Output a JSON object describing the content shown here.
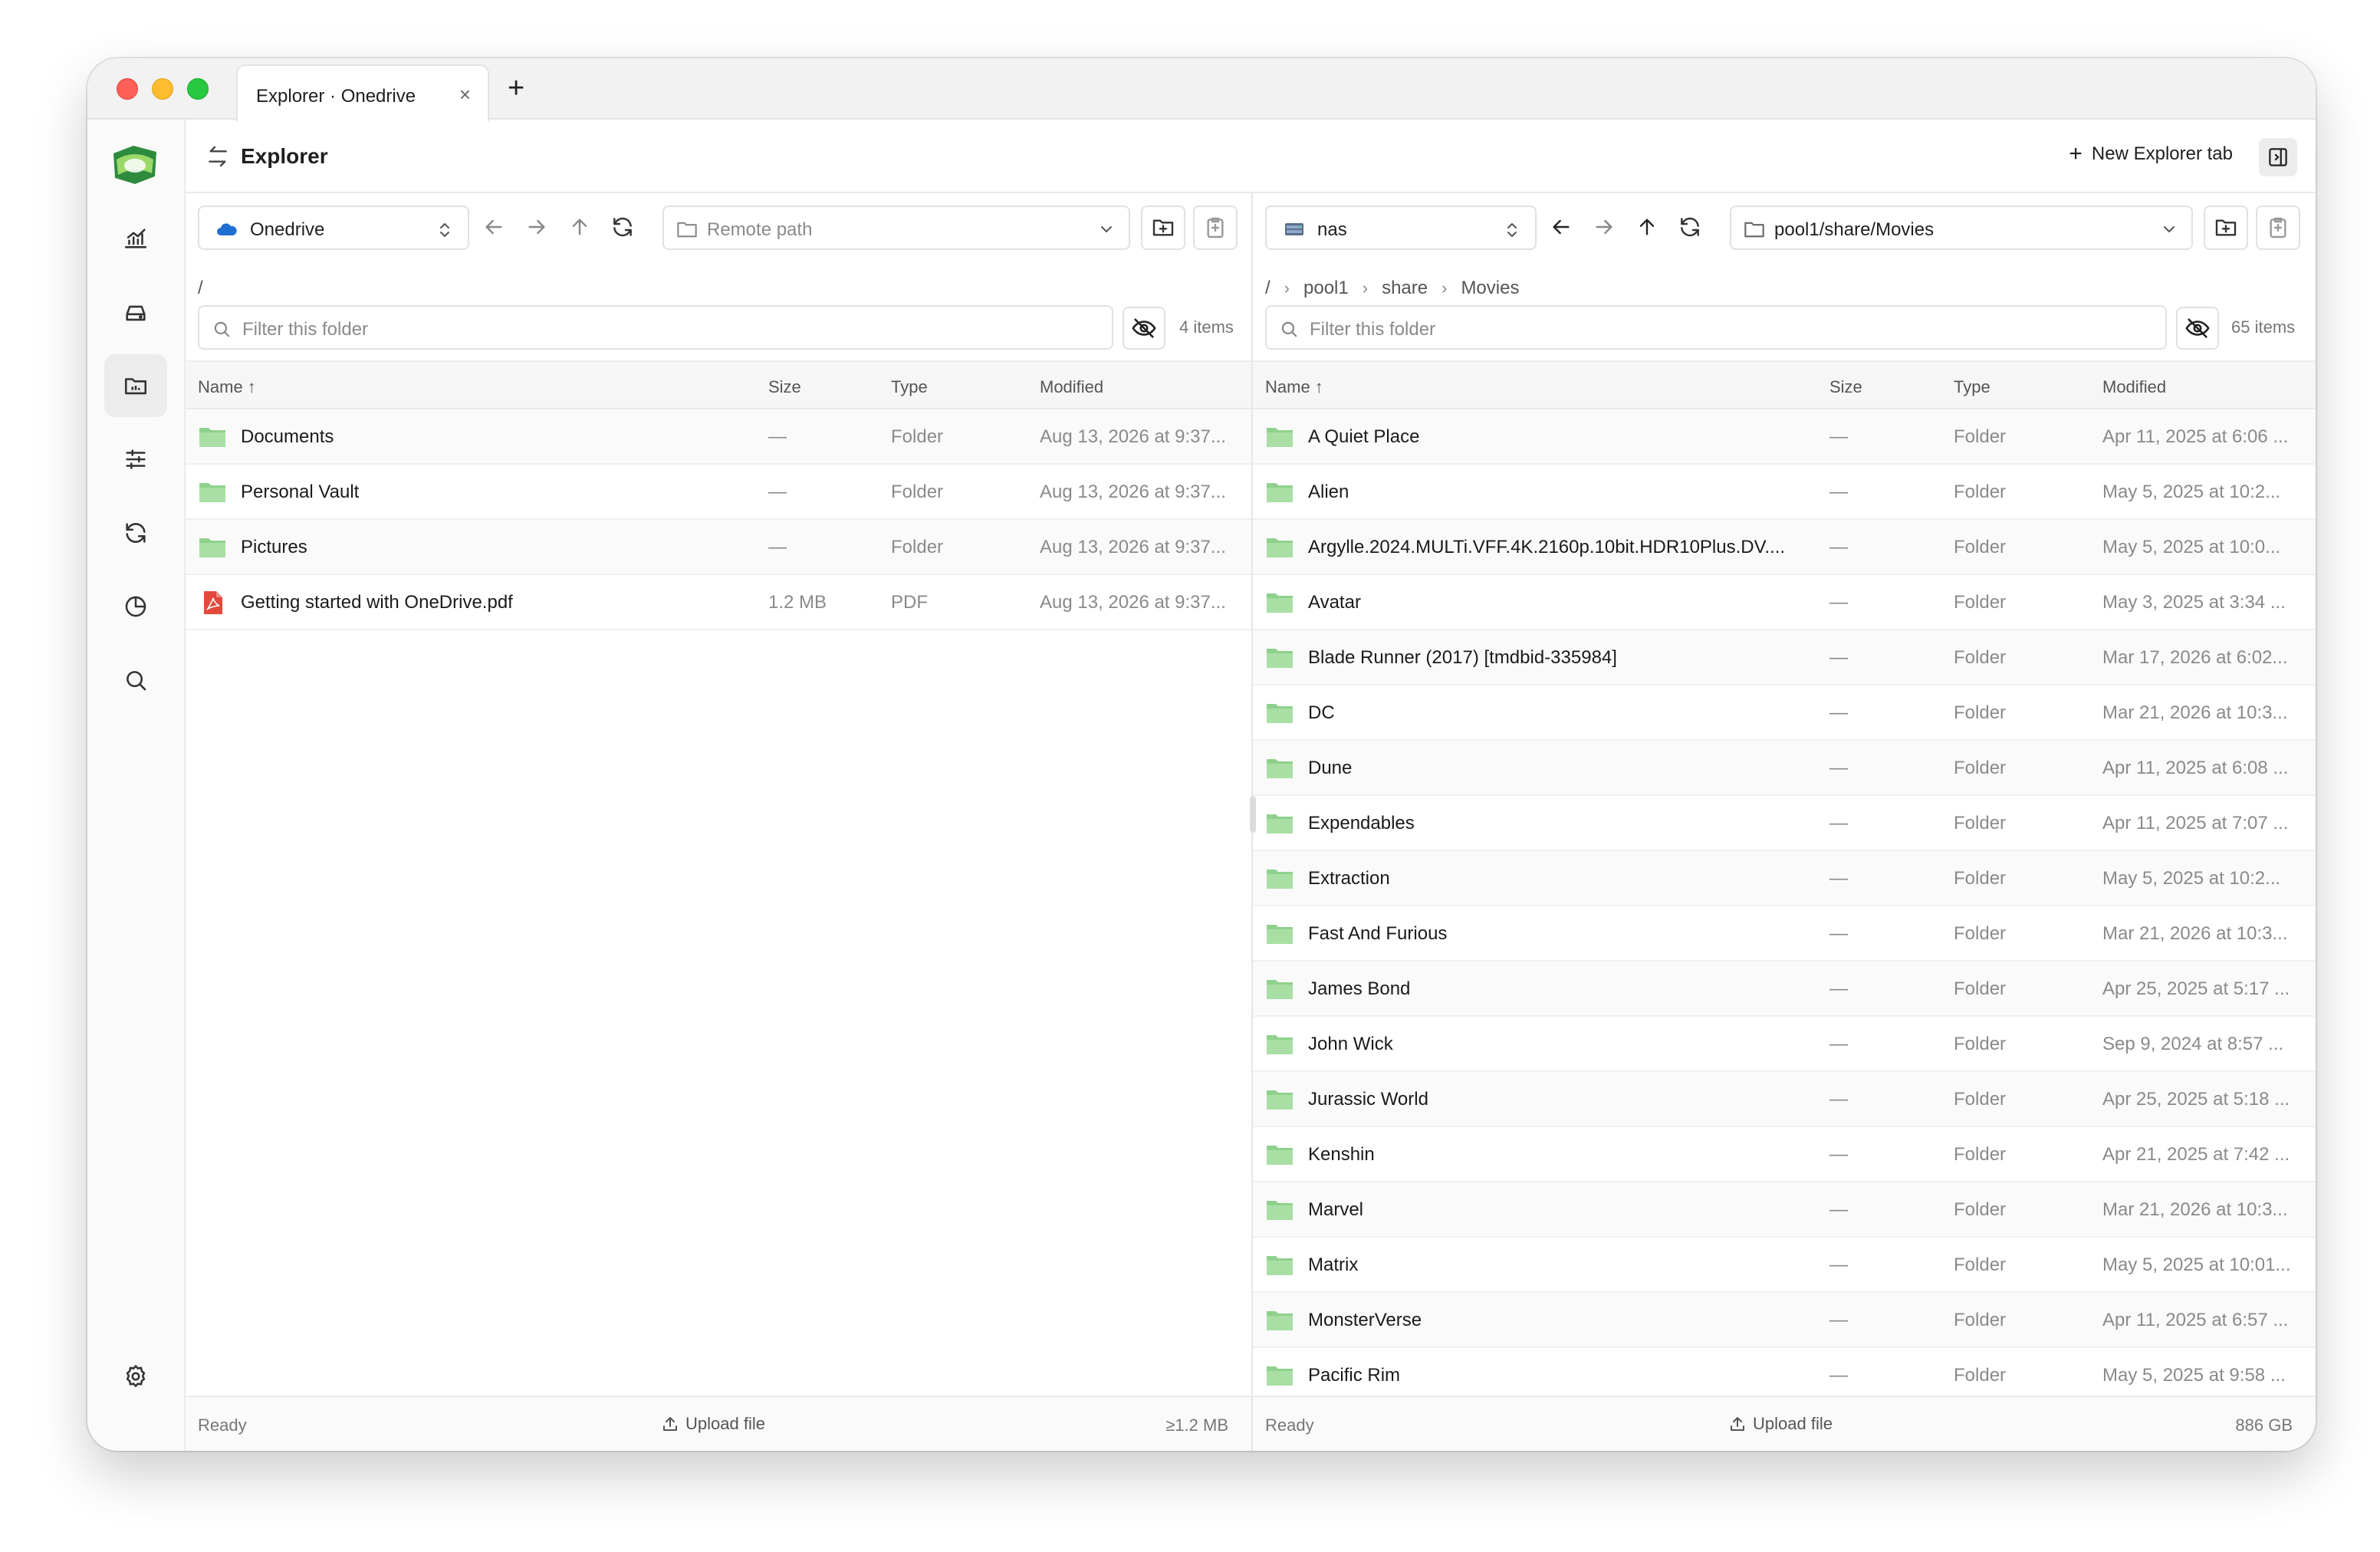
{
  "window": {
    "tab_title": "Explorer · Onedrive",
    "tab_close": "×",
    "tab_add": "+"
  },
  "colors": {
    "folder": "#8fd18c",
    "pdf": "#e2493d",
    "accent": "#3a7bd5"
  },
  "sidebar": {
    "items": [
      {
        "name": "dashboard",
        "icon": "chart-icon"
      },
      {
        "name": "remotes",
        "icon": "drive-icon"
      },
      {
        "name": "explorer",
        "icon": "folder-icon",
        "active": true
      },
      {
        "name": "settings",
        "icon": "sliders-icon"
      },
      {
        "name": "sync",
        "icon": "sync-icon"
      },
      {
        "name": "usage",
        "icon": "pie-icon"
      },
      {
        "name": "search",
        "icon": "search-icon"
      }
    ],
    "bottom": {
      "icon": "gear-icon"
    }
  },
  "header": {
    "title": "Explorer",
    "new_tab": "New Explorer tab"
  },
  "left": {
    "remote": "Onedrive",
    "path_placeholder": "Remote path",
    "breadcrumb": [
      "/"
    ],
    "filter_placeholder": "Filter this folder",
    "count": "4 items",
    "columns": {
      "name": "Name ↑",
      "size": "Size",
      "type": "Type",
      "modified": "Modified"
    },
    "rows": [
      {
        "name": "Documents",
        "size": "—",
        "type": "Folder",
        "modified": "Aug 13, 2026 at 9:37...",
        "kind": "folder"
      },
      {
        "name": "Personal Vault",
        "size": "—",
        "type": "Folder",
        "modified": "Aug 13, 2026 at 9:37...",
        "kind": "folder"
      },
      {
        "name": "Pictures",
        "size": "—",
        "type": "Folder",
        "modified": "Aug 13, 2026 at 9:37...",
        "kind": "folder"
      },
      {
        "name": "Getting started with OneDrive.pdf",
        "size": "1.2 MB",
        "type": "PDF",
        "modified": "Aug 13, 2026 at 9:37...",
        "kind": "pdf"
      }
    ],
    "footer": {
      "status": "Ready",
      "upload": "Upload file",
      "size": "≥1.2 MB"
    }
  },
  "right": {
    "remote": "nas",
    "path": "pool1/share/Movies",
    "breadcrumb": [
      "/",
      "pool1",
      "share",
      "Movies"
    ],
    "filter_placeholder": "Filter this folder",
    "count": "65 items",
    "columns": {
      "name": "Name ↑",
      "size": "Size",
      "type": "Type",
      "modified": "Modified"
    },
    "rows": [
      {
        "name": "A Quiet Place",
        "size": "—",
        "type": "Folder",
        "modified": "Apr 11, 2025 at 6:06 ..."
      },
      {
        "name": "Alien",
        "size": "—",
        "type": "Folder",
        "modified": "May 5, 2025 at 10:2..."
      },
      {
        "name": "Argylle.2024.MULTi.VFF.4K.2160p.10bit.HDR10Plus.DV....",
        "size": "—",
        "type": "Folder",
        "modified": "May 5, 2025 at 10:0..."
      },
      {
        "name": "Avatar",
        "size": "—",
        "type": "Folder",
        "modified": "May 3, 2025 at 3:34 ..."
      },
      {
        "name": "Blade Runner (2017) [tmdbid-335984]",
        "size": "—",
        "type": "Folder",
        "modified": "Mar 17, 2026 at 6:02..."
      },
      {
        "name": "DC",
        "size": "—",
        "type": "Folder",
        "modified": "Mar 21, 2026 at 10:3..."
      },
      {
        "name": "Dune",
        "size": "—",
        "type": "Folder",
        "modified": "Apr 11, 2025 at 6:08 ..."
      },
      {
        "name": "Expendables",
        "size": "—",
        "type": "Folder",
        "modified": "Apr 11, 2025 at 7:07 ..."
      },
      {
        "name": "Extraction",
        "size": "—",
        "type": "Folder",
        "modified": "May 5, 2025 at 10:2..."
      },
      {
        "name": "Fast And Furious",
        "size": "—",
        "type": "Folder",
        "modified": "Mar 21, 2026 at 10:3..."
      },
      {
        "name": "James Bond",
        "size": "—",
        "type": "Folder",
        "modified": "Apr 25, 2025 at 5:17 ..."
      },
      {
        "name": "John Wick",
        "size": "—",
        "type": "Folder",
        "modified": "Sep 9, 2024 at 8:57 ..."
      },
      {
        "name": "Jurassic World",
        "size": "—",
        "type": "Folder",
        "modified": "Apr 25, 2025 at 5:18 ..."
      },
      {
        "name": "Kenshin",
        "size": "—",
        "type": "Folder",
        "modified": "Apr 21, 2025 at 7:42 ..."
      },
      {
        "name": "Marvel",
        "size": "—",
        "type": "Folder",
        "modified": "Mar 21, 2026 at 10:3..."
      },
      {
        "name": "Matrix",
        "size": "—",
        "type": "Folder",
        "modified": "May 5, 2025 at 10:01..."
      },
      {
        "name": "MonsterVerse",
        "size": "—",
        "type": "Folder",
        "modified": "Apr 11, 2025 at 6:57 ..."
      },
      {
        "name": "Pacific Rim",
        "size": "—",
        "type": "Folder",
        "modified": "May 5, 2025 at 9:58 ..."
      }
    ],
    "footer": {
      "status": "Ready",
      "upload": "Upload file",
      "size": "886 GB"
    }
  }
}
